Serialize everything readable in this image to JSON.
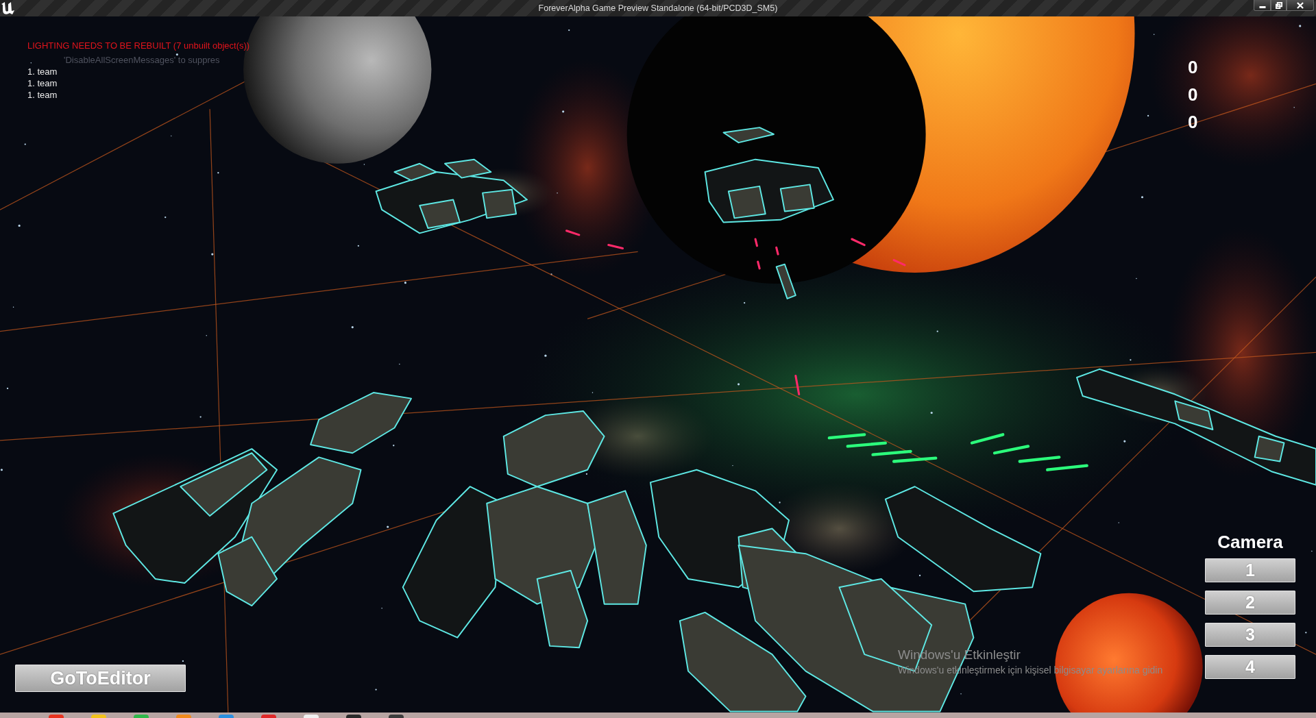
{
  "window": {
    "title": "ForeverAlpha Game Preview Standalone (64-bit/PCD3D_SM5)"
  },
  "screen_messages": [
    {
      "kind": "warning",
      "text": "LIGHTING NEEDS TO BE REBUILT (7 unbuilt object(s))"
    },
    {
      "kind": "hint",
      "text": "'DisableAllScreenMessages' to suppres"
    }
  ],
  "team_list": [
    "1. team",
    "1. team",
    "1. team"
  ],
  "scores": [
    "0",
    "0",
    "0"
  ],
  "camera_panel": {
    "title": "Camera",
    "buttons": [
      "1",
      "2",
      "3",
      "4"
    ]
  },
  "editor_button": {
    "label": "GoToEditor"
  },
  "activation_notice": {
    "title": "Windows'u Etkinleştir",
    "text": "Windows'u etkinleştirmek için kişisel bilgisayar ayarlarına gidin"
  }
}
